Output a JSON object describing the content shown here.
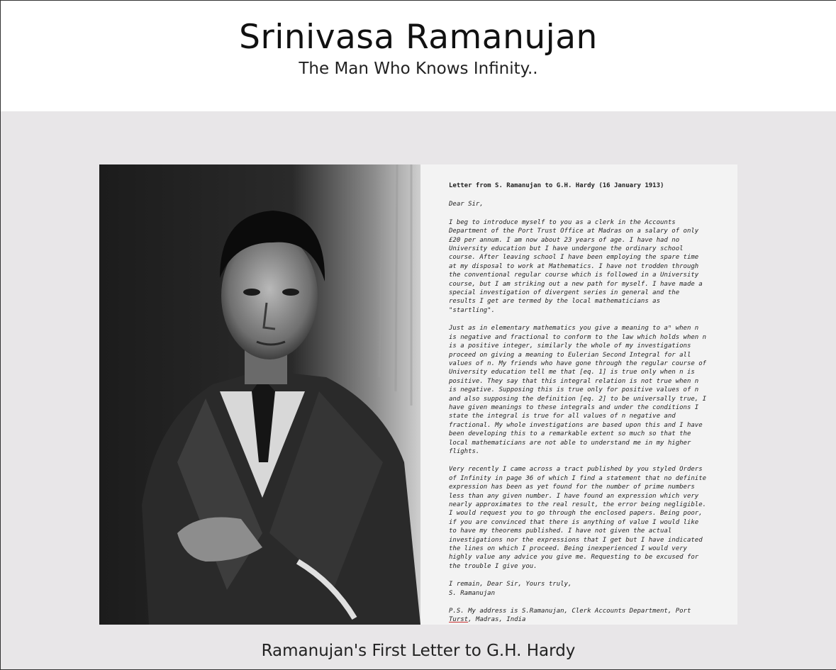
{
  "header": {
    "title": "Srinivasa Ramanujan",
    "subtitle": "The Man Who Knows Infinity.."
  },
  "letter": {
    "heading": "Letter from S. Ramanujan to G.H. Hardy (16 January 1913)",
    "salutation": "Dear Sir,",
    "para1": "I beg to introduce myself to you as a clerk in the Accounts Department of the Port Trust Office at Madras on a salary of only £20 per annum. I am now about 23 years of age. I have had no University education but I have undergone the ordinary school course. After leaving school I have been employing the spare time at my disposal to work at Mathematics. I have not trodden through the conventional regular course which is followed in a University course, but I am striking out a new path for myself. I have made a special investigation of divergent series in general and the results I get are termed by the local mathematicians as \"startling\".",
    "para2": "Just as in elementary mathematics you give a meaning to aⁿ when n is negative and fractional to conform to the law which holds when n is a positive integer, similarly the whole of my investigations proceed on giving a meaning to Eulerian Second Integral for all values of n. My friends who have gone through the regular course of University education tell me that [eq. 1] is true only when n is positive. They say that this integral relation is not true when n is negative. Supposing this is true only for positive values of n and also supposing the definition [eq. 2] to be universally true, I have given meanings to these integrals and under the conditions I state the integral is true for all values of n negative and fractional. My whole investigations are based upon this and I have been developing this to a remarkable extent so much so that the local mathematicians are not able to understand me in my higher flights.",
    "para3": "Very recently I came across a tract published by you styled Orders of Infinity in page 36 of which I find a statement that no definite expression has been as yet found for the number of prime numbers less than any given number. I have found an expression which very nearly approximates to the real result, the error being negligible. I would request you to go through the enclosed papers. Being poor, if you are convinced that there is anything of value I would like to have my theorems published. I have not given the actual investigations nor the expressions that I get but I have indicated the lines on which I proceed. Being inexperienced I would very highly value any advice you give me. Requesting to be excused for the trouble I give you.",
    "closing": "I remain, Dear Sir, Yours truly,",
    "signature": "S. Ramanujan",
    "ps_prefix": "P.S. My address is S.Ramanujan, Clerk Accounts Department, Port",
    "ps_underlined": "Turst",
    "ps_suffix": ", Madras, India"
  },
  "caption": "Ramanujan's First Letter to G.H. Hardy"
}
